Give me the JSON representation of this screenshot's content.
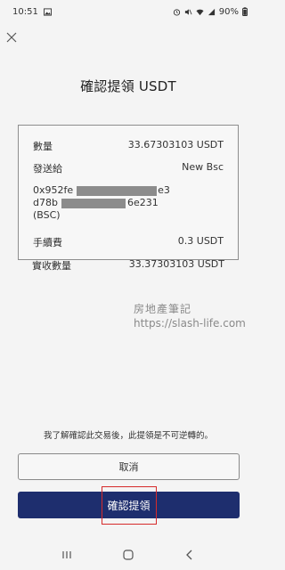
{
  "status_bar": {
    "time": "10:51",
    "battery": "90%"
  },
  "header": {
    "title": "確認提領 USDT"
  },
  "details": {
    "amount_label": "數量",
    "amount_value": "33.67303103 USDT",
    "send_to_label": "發送給",
    "send_to_value": "New Bsc",
    "address_line1_start": "0x952fe",
    "address_line1_end": "e3",
    "address_line2_start": "d78b",
    "address_line2_end": "6e231",
    "address_network": "(BSC)",
    "fee_label": "手續費",
    "fee_value": "0.3 USDT",
    "received_label": "實收數量",
    "received_value": "33.37303103 USDT"
  },
  "watermark": {
    "line1": "房地產筆記",
    "line2": "https://slash-life.com"
  },
  "footer": {
    "disclaimer": "我了解確認此交易後，此提領是不可逆轉的。",
    "cancel_label": "取消",
    "confirm_label": "確認提領"
  },
  "colors": {
    "primary": "#1e2e6e",
    "highlight": "#d62b2b",
    "background": "#f4f4f4"
  },
  "icons": {
    "close": "close-icon",
    "nav_recent": "recent-apps-icon",
    "nav_home": "home-icon",
    "nav_back": "back-icon"
  }
}
